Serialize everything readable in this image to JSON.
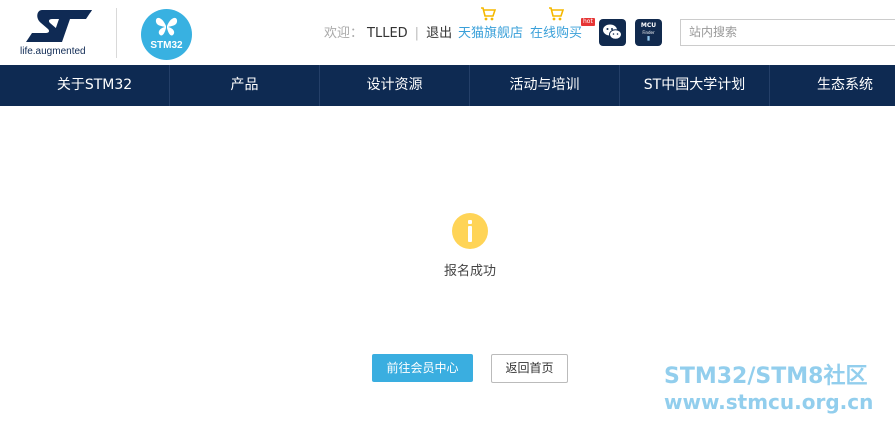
{
  "header": {
    "tagline": "life.augmented",
    "stm_badge": "STM32",
    "welcome": "欢迎：",
    "username": "TLLED",
    "separator": "|",
    "logout": "退出",
    "shop_tmall": "天猫旗舰店",
    "shop_online": "在线购买",
    "hot_badge": "hot",
    "mcu_icon": {
      "line1": "MCU",
      "line2": "Finder"
    },
    "search_placeholder": "站内搜索"
  },
  "nav": {
    "items": [
      "关于STM32",
      "产品",
      "设计资源",
      "活动与培训",
      "ST中国大学计划",
      "生态系统"
    ]
  },
  "content": {
    "message": "报名成功",
    "primary_button": "前往会员中心",
    "secondary_button": "返回首页"
  },
  "watermark": {
    "line1": "STM32/STM8社区",
    "line2": "www.stmcu.org.cn"
  },
  "icons": {
    "st_logo": "st-logo-icon",
    "butterfly": "butterfly-icon",
    "cart": "shopping-cart-icon",
    "wechat": "wechat-icon",
    "info": "info-icon"
  },
  "colors": {
    "nav_bg": "#0e2a52",
    "link_blue": "#3aa0d9",
    "primary_button": "#3aaee0",
    "info_icon": "#ffd457",
    "stm_badge": "#38b1e1"
  }
}
